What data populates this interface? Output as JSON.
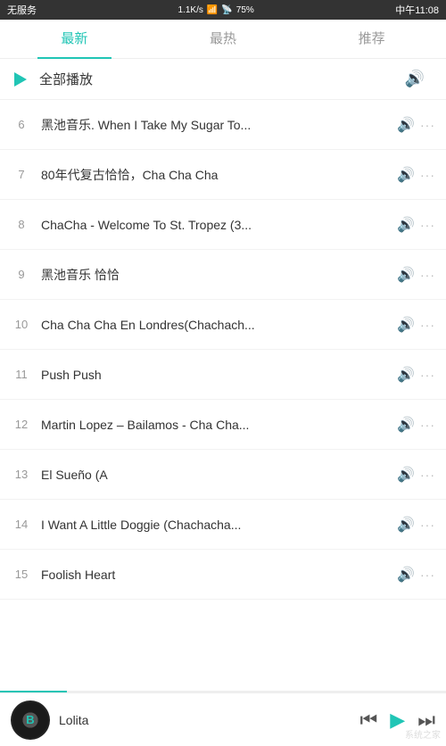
{
  "statusBar": {
    "carrier": "无服务",
    "speed": "1.1K/s",
    "wifi": "WiFi",
    "signal": "4G",
    "battery": "75%",
    "time": "中午11:08"
  },
  "tabs": [
    {
      "id": "latest",
      "label": "最新",
      "active": true
    },
    {
      "id": "hot",
      "label": "最热",
      "active": false
    },
    {
      "id": "recommend",
      "label": "推荐",
      "active": false
    }
  ],
  "playAll": {
    "label": "全部播放"
  },
  "songs": [
    {
      "num": "6",
      "title": "黑池音乐. When I Take My Sugar To..."
    },
    {
      "num": "7",
      "title": "80年代复古恰恰，Cha Cha Cha"
    },
    {
      "num": "8",
      "title": "ChaCha - Welcome To St. Tropez (3..."
    },
    {
      "num": "9",
      "title": "黑池音乐 恰恰"
    },
    {
      "num": "10",
      "title": "Cha Cha Cha En Londres(Chachach..."
    },
    {
      "num": "11",
      "title": "Push Push"
    },
    {
      "num": "12",
      "title": "Martin Lopez – Bailamos - Cha Cha..."
    },
    {
      "num": "13",
      "title": "El Sueño (A"
    },
    {
      "num": "14",
      "title": "I Want A Little Doggie (Chachacha..."
    },
    {
      "num": "15",
      "title": "Foolish Heart"
    }
  ],
  "player": {
    "albumLabel": "B",
    "songTitle": "Lolita",
    "prevBtn": "⏮",
    "playBtn": "▶",
    "nextBtn": "⏭"
  },
  "icons": {
    "speakerUnicode": "🔊",
    "dotsUnicode": "···",
    "playTriangle": "▶"
  }
}
